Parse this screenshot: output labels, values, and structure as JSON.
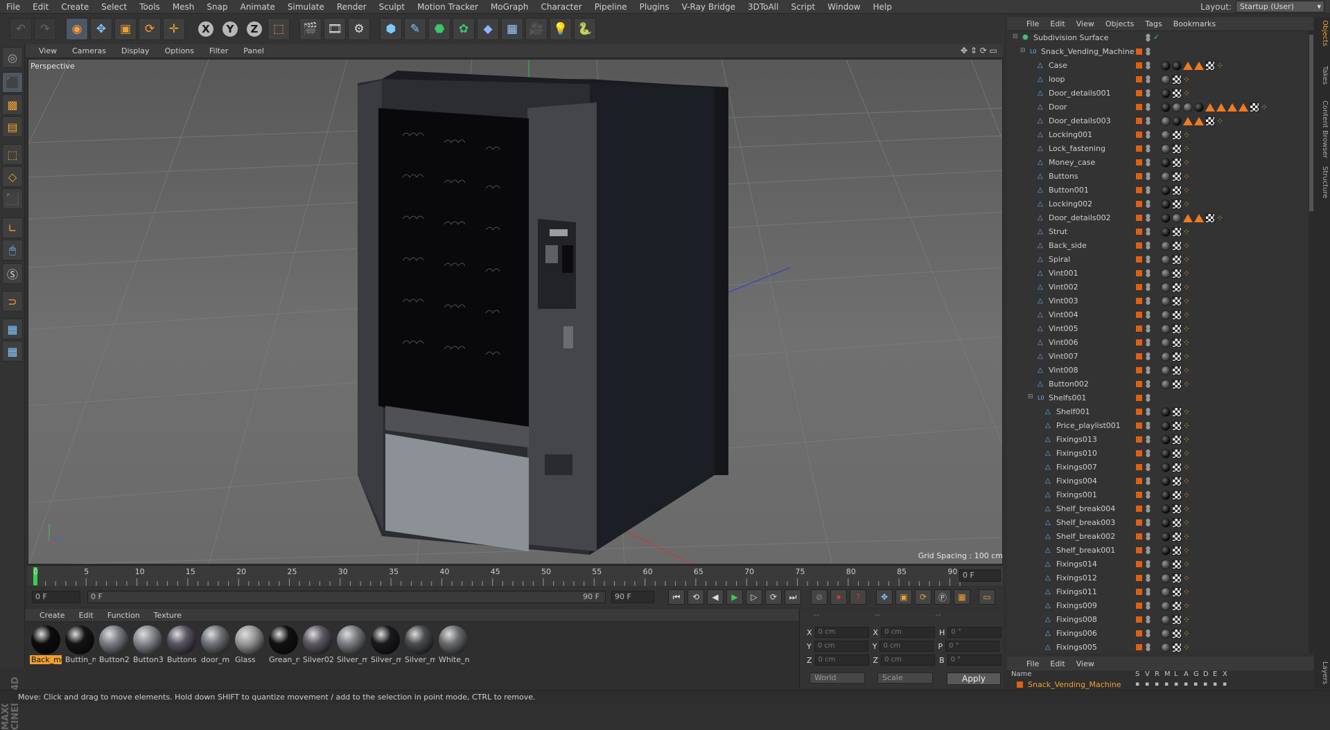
{
  "menu": [
    "File",
    "Edit",
    "Create",
    "Select",
    "Tools",
    "Mesh",
    "Snap",
    "Animate",
    "Simulate",
    "Render",
    "Sculpt",
    "Motion Tracker",
    "MoGraph",
    "Character",
    "Pipeline",
    "Plugins",
    "V-Ray Bridge",
    "3DToAll",
    "Script",
    "Window",
    "Help"
  ],
  "layout": {
    "label": "Layout:",
    "value": "Startup (User)"
  },
  "viewport": {
    "menu": [
      "View",
      "Cameras",
      "Display",
      "Options",
      "Filter",
      "Panel"
    ],
    "camera_label": "Perspective",
    "grid_spacing": "Grid Spacing : 100 cm"
  },
  "timeline": {
    "ticks": [
      "0",
      "5",
      "10",
      "15",
      "20",
      "25",
      "30",
      "35",
      "40",
      "45",
      "50",
      "55",
      "60",
      "65",
      "70",
      "75",
      "80",
      "85",
      "90"
    ],
    "current_frame": "0 F",
    "start": "0 F",
    "range_start": "0 F",
    "range_end": "90 F",
    "end": "90 F"
  },
  "materials": {
    "menu": [
      "Create",
      "Edit",
      "Function",
      "Texture"
    ],
    "items": [
      {
        "name": "Back_me",
        "color": "#0c0c0c",
        "selected": true
      },
      {
        "name": "Buttin_n",
        "color": "#141414"
      },
      {
        "name": "Button2",
        "color": "#7a7f85"
      },
      {
        "name": "Button3",
        "color": "#858a8e"
      },
      {
        "name": "Buttons",
        "color": "#5c5564"
      },
      {
        "name": "door_m",
        "color": "#6f7478"
      },
      {
        "name": "Glass",
        "color": "#9a9a9a"
      },
      {
        "name": "Grean_n",
        "color": "#111111"
      },
      {
        "name": "Silver02",
        "color": "#5f5a66"
      },
      {
        "name": "Silver_m",
        "color": "#7b7e82"
      },
      {
        "name": "Silver_m",
        "color": "#1a1a1e"
      },
      {
        "name": "Silver_m",
        "color": "#4a4d50"
      },
      {
        "name": "White_n",
        "color": "#6a6d70"
      }
    ]
  },
  "coordinates": {
    "header": [
      "--",
      "--",
      "--"
    ],
    "rows": [
      {
        "a": "X",
        "av": "0 cm",
        "b": "X",
        "bv": "0 cm",
        "c": "H",
        "cv": "0 °"
      },
      {
        "a": "Y",
        "av": "0 cm",
        "b": "Y",
        "bv": "0 cm",
        "c": "P",
        "cv": "0 °"
      },
      {
        "a": "Z",
        "av": "0 cm",
        "b": "Z",
        "bv": "0 cm",
        "c": "B",
        "cv": "0 °"
      }
    ],
    "space": "World",
    "mode": "Scale",
    "apply": "Apply"
  },
  "status": "Move: Click and drag to move elements. Hold down SHIFT to quantize movement / add to the selection in point mode, CTRL to remove.",
  "objects": {
    "menu": [
      "File",
      "Edit",
      "View",
      "Objects",
      "Tags",
      "Bookmarks"
    ],
    "rows": [
      {
        "name": "Subdivision Surface",
        "indent": 0,
        "type": "subd"
      },
      {
        "name": "Snack_Vending_Machine",
        "indent": 1,
        "type": "null"
      },
      {
        "name": "Case",
        "indent": 2,
        "tags": "d d tri tri ck phg"
      },
      {
        "name": "loop",
        "indent": 2,
        "tags": "m ck phg"
      },
      {
        "name": "Door_details001",
        "indent": 2,
        "tags": "d ck phg"
      },
      {
        "name": "Door",
        "indent": 2,
        "tags": "d m m d tri tri tri tri ck phg"
      },
      {
        "name": "Door_details003",
        "indent": 2,
        "tags": "m d tri tri ck phg"
      },
      {
        "name": "Locking001",
        "indent": 2,
        "tags": "m ck phg"
      },
      {
        "name": "Lock_fastening",
        "indent": 2,
        "tags": "m ck phg"
      },
      {
        "name": "Money_case",
        "indent": 2,
        "tags": "d ck phg"
      },
      {
        "name": "Buttons",
        "indent": 2,
        "tags": "m ck phg"
      },
      {
        "name": "Button001",
        "indent": 2,
        "tags": "d ck phg"
      },
      {
        "name": "Locking002",
        "indent": 2,
        "tags": "d ck phg"
      },
      {
        "name": "Door_details002",
        "indent": 2,
        "tags": "d m tri tri ck phg"
      },
      {
        "name": "Strut",
        "indent": 2,
        "tags": "d ck phg"
      },
      {
        "name": "Back_side",
        "indent": 2,
        "tags": "m ck phg"
      },
      {
        "name": "Spiral",
        "indent": 2,
        "tags": "m ck phg"
      },
      {
        "name": "Vint001",
        "indent": 2,
        "tags": "m ck phg"
      },
      {
        "name": "Vint002",
        "indent": 2,
        "tags": "m ck phg"
      },
      {
        "name": "Vint003",
        "indent": 2,
        "tags": "m ck phg"
      },
      {
        "name": "Vint004",
        "indent": 2,
        "tags": "m ck phg"
      },
      {
        "name": "Vint005",
        "indent": 2,
        "tags": "m ck phg"
      },
      {
        "name": "Vint006",
        "indent": 2,
        "tags": "m ck phg"
      },
      {
        "name": "Vint007",
        "indent": 2,
        "tags": "m ck phg"
      },
      {
        "name": "Vint008",
        "indent": 2,
        "tags": "m ck phg"
      },
      {
        "name": "Button002",
        "indent": 2,
        "tags": "m ck phg"
      },
      {
        "name": "Shelfs001",
        "indent": 2,
        "type": "null"
      },
      {
        "name": "Shelf001",
        "indent": 3,
        "tags": "d ck phg"
      },
      {
        "name": "Price_playlist001",
        "indent": 3,
        "tags": "d ck phg"
      },
      {
        "name": "Fixings013",
        "indent": 3,
        "tags": "d ck phg"
      },
      {
        "name": "Fixings010",
        "indent": 3,
        "tags": "d ck phg"
      },
      {
        "name": "Fixings007",
        "indent": 3,
        "tags": "d ck phg"
      },
      {
        "name": "Fixings004",
        "indent": 3,
        "tags": "d ck phg"
      },
      {
        "name": "Fixings001",
        "indent": 3,
        "tags": "d ck phg"
      },
      {
        "name": "Shelf_break004",
        "indent": 3,
        "tags": "d ck phg"
      },
      {
        "name": "Shelf_break003",
        "indent": 3,
        "tags": "d ck phg"
      },
      {
        "name": "Shelf_break002",
        "indent": 3,
        "tags": "d ck phg"
      },
      {
        "name": "Shelf_break001",
        "indent": 3,
        "tags": "d ck phg"
      },
      {
        "name": "Fixings014",
        "indent": 3,
        "tags": "m ck phg"
      },
      {
        "name": "Fixings012",
        "indent": 3,
        "tags": "m ck phg"
      },
      {
        "name": "Fixings011",
        "indent": 3,
        "tags": "m ck phg"
      },
      {
        "name": "Fixings009",
        "indent": 3,
        "tags": "m ck phg"
      },
      {
        "name": "Fixings008",
        "indent": 3,
        "tags": "m ck phg"
      },
      {
        "name": "Fixings006",
        "indent": 3,
        "tags": "m ck phg"
      },
      {
        "name": "Fixings005",
        "indent": 3,
        "tags": "m ck phg"
      }
    ]
  },
  "side_tabs": [
    "Objects",
    "Takes",
    "Content Browser",
    "Structure",
    "Layers"
  ],
  "layers": {
    "menu": [
      "File",
      "Edit",
      "View"
    ],
    "name_col": "Name",
    "cols": [
      "S",
      "V",
      "R",
      "M",
      "L",
      "A",
      "G",
      "D",
      "E",
      "X"
    ],
    "row": "Snack_Vending_Machine"
  }
}
